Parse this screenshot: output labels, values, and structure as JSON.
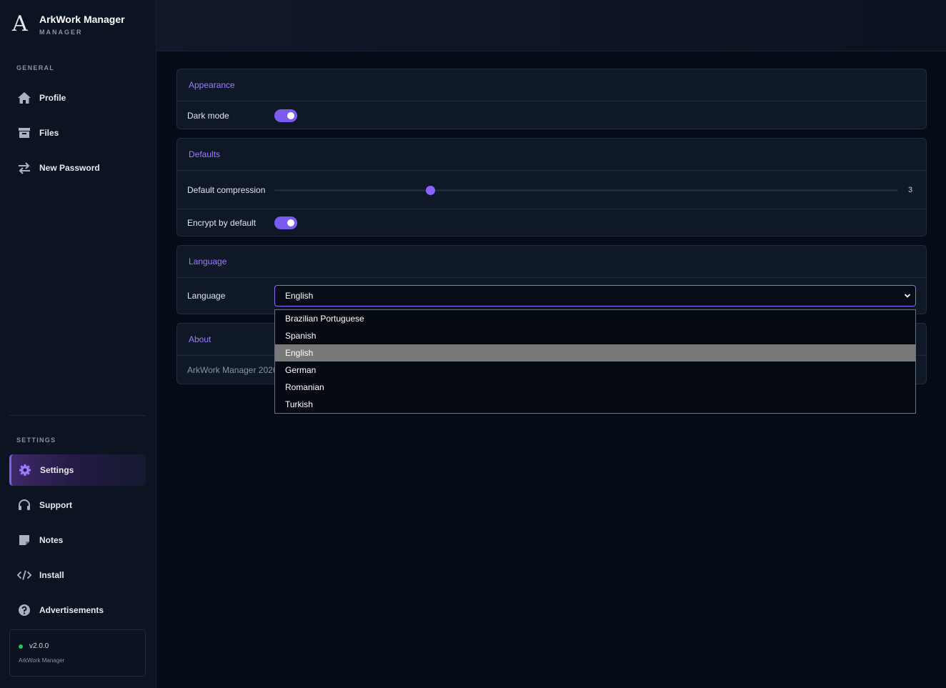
{
  "app": {
    "logo_letter": "A",
    "title": "ArkWork Manager",
    "subtitle": "MANAGER"
  },
  "sidebar": {
    "general_label": "GENERAL",
    "general_items": [
      {
        "label": "Profile",
        "icon": "home-icon"
      },
      {
        "label": "Files",
        "icon": "archive-icon"
      },
      {
        "label": "New Password",
        "icon": "swap-arrows-icon"
      }
    ],
    "settings_label": "SETTINGS",
    "settings_items": [
      {
        "label": "Settings",
        "icon": "gear-icon",
        "active": true
      },
      {
        "label": "Support",
        "icon": "headset-icon"
      },
      {
        "label": "Notes",
        "icon": "note-icon"
      },
      {
        "label": "Install",
        "icon": "code-icon"
      },
      {
        "label": "Advertisements",
        "icon": "question-icon"
      }
    ],
    "version": "v2.0.0",
    "version_app": "ArkWork Manager",
    "status_color": "#22c55e"
  },
  "appearance": {
    "title": "Appearance",
    "dark_mode_label": "Dark mode",
    "dark_mode": true
  },
  "defaults": {
    "title": "Defaults",
    "compression_label": "Default compression",
    "compression_value": "3",
    "compression_fraction": 0.25,
    "encrypt_label": "Encrypt by default",
    "encrypt": true
  },
  "language": {
    "title": "Language",
    "label": "Language",
    "selected": "English",
    "options": [
      "Brazilian Portuguese",
      "Spanish",
      "English",
      "German",
      "Romanian",
      "Turkish"
    ]
  },
  "about": {
    "title": "About",
    "text": "ArkWork Manager 2026"
  },
  "colors": {
    "accent": "#7c5cf0",
    "background": "#060c17",
    "sidebar": "#0c1422"
  }
}
